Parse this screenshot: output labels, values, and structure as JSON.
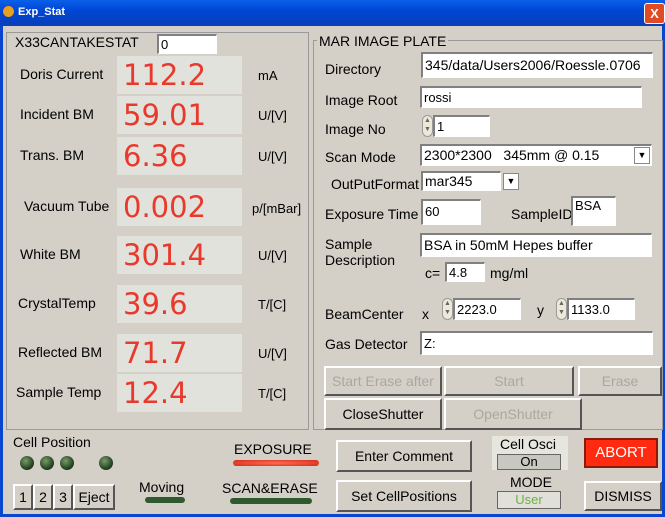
{
  "window": {
    "title": "Exp_Stat",
    "close_glyph": "X"
  },
  "left": {
    "header_label": "X33CANTAKESTAT",
    "header_value": "0",
    "rows": [
      {
        "label": "Doris Current",
        "value": "112.2",
        "unit": "mA"
      },
      {
        "label": "Incident BM",
        "value": "59.01",
        "unit": "U/[V]"
      },
      {
        "label": "Trans. BM",
        "value": "6.36",
        "unit": "U/[V]"
      },
      {
        "label": "Vacuum Tube",
        "value": "0.002",
        "unit": "p/[mBar]"
      },
      {
        "label": "White BM",
        "value": "301.4",
        "unit": "U/[V]"
      },
      {
        "label": "CrystalTemp",
        "value": "39.6",
        "unit": "T/[C]"
      },
      {
        "label": "Reflected BM",
        "value": "71.7",
        "unit": "U/[V]"
      },
      {
        "label": "Sample Temp",
        "value": "12.4",
        "unit": "T/[C]"
      }
    ]
  },
  "plate": {
    "title": "MAR IMAGE PLATE",
    "directory_label": "Directory",
    "directory_value": "345/data/Users2006/Roessle.0706",
    "image_root_label": "Image Root",
    "image_root_value": "rossi",
    "image_no_label": "Image No",
    "image_no_value": "1",
    "scan_mode_label": "Scan Mode",
    "scan_mode_value": "2300*2300   345mm @ 0.15",
    "output_format_label": "OutPutFormat",
    "output_format_value": "mar345",
    "exposure_time_label": "Exposure Time",
    "exposure_time_value": "60",
    "sample_id_label": "SampleID",
    "sample_id_value": "BSA",
    "sample_desc_label_1": "Sample",
    "sample_desc_label_2": "Description",
    "sample_desc_value": "BSA in 50mM Hepes buffer",
    "conc_label": "c=",
    "conc_value": "4.8",
    "conc_unit": "mg/ml",
    "beamcenter_label": "BeamCenter",
    "x_label": "x",
    "x_value": "2223.0",
    "y_label": "y",
    "y_value": "1133.0",
    "gas_detector_label": "Gas Detector",
    "gas_detector_value": "Z:",
    "start_erase_after": "Start Erase after",
    "start": "Start",
    "erase": "Erase",
    "close_shutter": "CloseShutter",
    "open_shutter": "OpenShutter"
  },
  "bottom": {
    "cell_position_label": "Cell Position",
    "exposure_label": "EXPOSURE",
    "scan_erase_label": "SCAN&ERASE",
    "moving_label": "Moving",
    "cell_buttons": [
      "1",
      "2",
      "3",
      "Eject"
    ],
    "enter_comment": "Enter Comment",
    "set_cell_positions": "Set CellPositions",
    "cell_osci_label": "Cell Osci",
    "cell_osci_value": "On",
    "mode_label": "MODE",
    "mode_value": "User",
    "abort": "ABORT",
    "dismiss": "DISMISS"
  },
  "colors": {
    "value_red": "#e8392c",
    "abort_red": "#ff2a10",
    "exposure_bar": "#e63a2a",
    "scan_bar": "#2f5a2f",
    "mode_green": "#6ab04a",
    "titlebar_blue": "#0046d5"
  },
  "icons": {
    "window": "app-icon",
    "close": "close-icon",
    "spinner": "spinner-icon",
    "dropdown": "chevron-down-icon"
  }
}
